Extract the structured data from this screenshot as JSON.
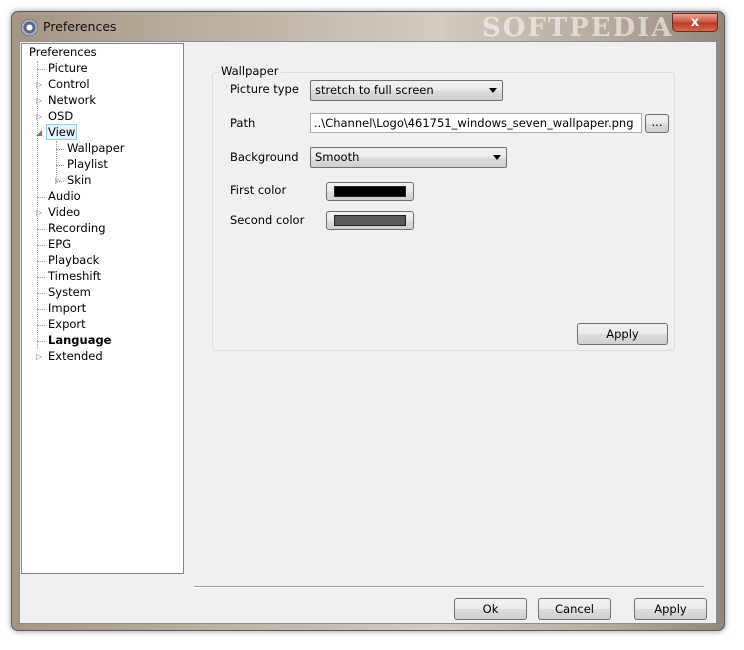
{
  "window": {
    "title": "Preferences",
    "watermark": "SOFTPEDIA",
    "close_label": "x"
  },
  "tree": {
    "root": "Preferences",
    "items": [
      {
        "label": "Picture",
        "expandable": false
      },
      {
        "label": "Control",
        "expandable": true
      },
      {
        "label": "Network",
        "expandable": true
      },
      {
        "label": "OSD",
        "expandable": true
      },
      {
        "label": "View",
        "expandable": true,
        "expanded": true,
        "selected": true
      },
      {
        "label": "Wallpaper",
        "child": true
      },
      {
        "label": "Playlist",
        "child": true
      },
      {
        "label": "Skin",
        "child": true,
        "expandable": true
      },
      {
        "label": "Audio",
        "expandable": false
      },
      {
        "label": "Video",
        "expandable": true
      },
      {
        "label": "Recording",
        "expandable": false
      },
      {
        "label": "EPG",
        "expandable": false
      },
      {
        "label": "Playback",
        "expandable": false
      },
      {
        "label": "Timeshift",
        "expandable": false
      },
      {
        "label": "System",
        "expandable": false
      },
      {
        "label": "Import",
        "expandable": false
      },
      {
        "label": "Export",
        "expandable": false
      },
      {
        "label": "Language",
        "expandable": false,
        "bold": true
      },
      {
        "label": "Extended",
        "expandable": true
      }
    ]
  },
  "wallpaper": {
    "group_title": "Wallpaper",
    "picture_type_label": "Picture type",
    "picture_type_value": "stretch to full screen",
    "path_label": "Path",
    "path_value": "..\\Channel\\Logo\\461751_windows_seven_wallpaper.png",
    "browse_label": "...",
    "background_label": "Background",
    "background_value": "Smooth",
    "first_color_label": "First color",
    "first_color": "#000000",
    "second_color_label": "Second color",
    "second_color": "#5a5a5a",
    "apply_label": "Apply"
  },
  "footer": {
    "ok_label": "Ok",
    "cancel_label": "Cancel",
    "apply_label": "Apply"
  }
}
